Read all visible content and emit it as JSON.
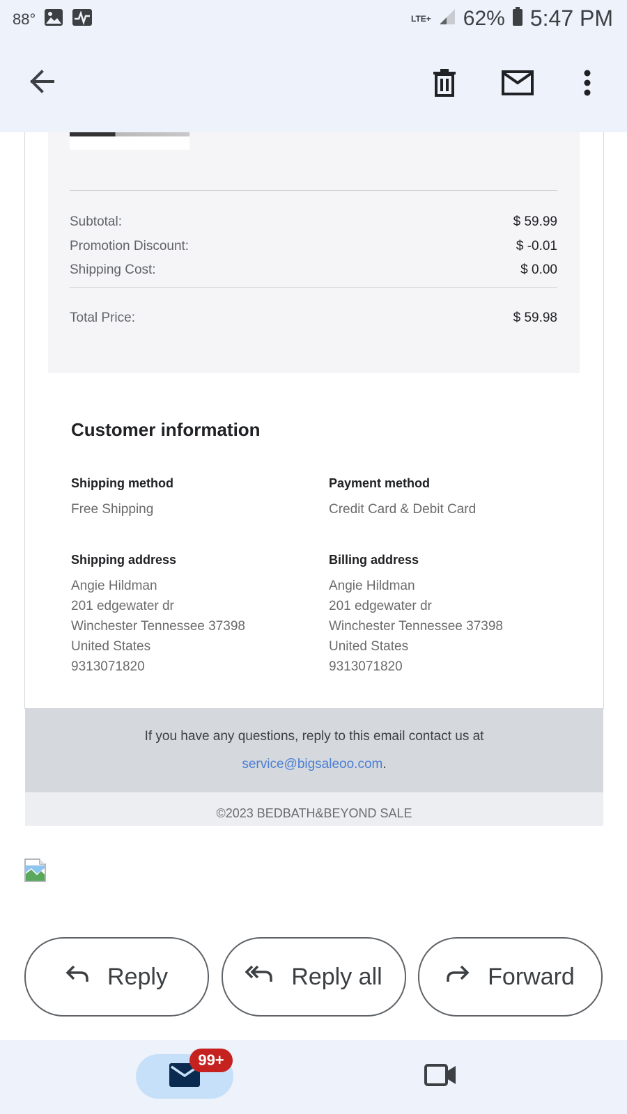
{
  "status_bar": {
    "temperature": "88°",
    "network": "LTE+",
    "battery_percent": "62%",
    "time": "5:47 PM"
  },
  "toolbar": {
    "back_icon": "arrow-left-icon",
    "delete_icon": "trash-icon",
    "mark_unread_icon": "envelope-icon",
    "more_icon": "more-vert-icon"
  },
  "order_summary": {
    "subtotal_label": "Subtotal:",
    "subtotal_value": "$ 59.99",
    "discount_label": "Promotion Discount:",
    "discount_value": "$ -0.01",
    "shipping_label": "Shipping Cost:",
    "shipping_value": "$ 0.00",
    "total_label": "Total Price:",
    "total_value": "$ 59.98"
  },
  "customer_info": {
    "title": "Customer information",
    "shipping_method_label": "Shipping method",
    "shipping_method_value": "Free Shipping",
    "payment_method_label": "Payment method",
    "payment_method_value": "Credit Card & Debit Card",
    "shipping_address_label": "Shipping address",
    "shipping_address": {
      "name": "Angie Hildman",
      "street": "201 edgewater dr",
      "city_line": "Winchester Tennessee 37398",
      "country": "United States",
      "phone": "9313071820"
    },
    "billing_address_label": "Billing address",
    "billing_address": {
      "name": "Angie Hildman",
      "street": "201 edgewater dr",
      "city_line": "Winchester Tennessee 37398",
      "country": "United States",
      "phone": "9313071820"
    }
  },
  "footer": {
    "help_text": "If you have any questions, reply to this email contact us at",
    "email": "service@bigsaleoo.com",
    "email_suffix": ".",
    "copyright": "©2023 BEDBATH&BEYOND SALE"
  },
  "actions": {
    "reply_label": "Reply",
    "reply_all_label": "Reply all",
    "forward_label": "Forward"
  },
  "bottom_nav": {
    "mail_badge": "99+"
  },
  "colors": {
    "link": "#4a7fd4",
    "badge": "#c5221f",
    "mail_pill": "#c7e0f9"
  }
}
